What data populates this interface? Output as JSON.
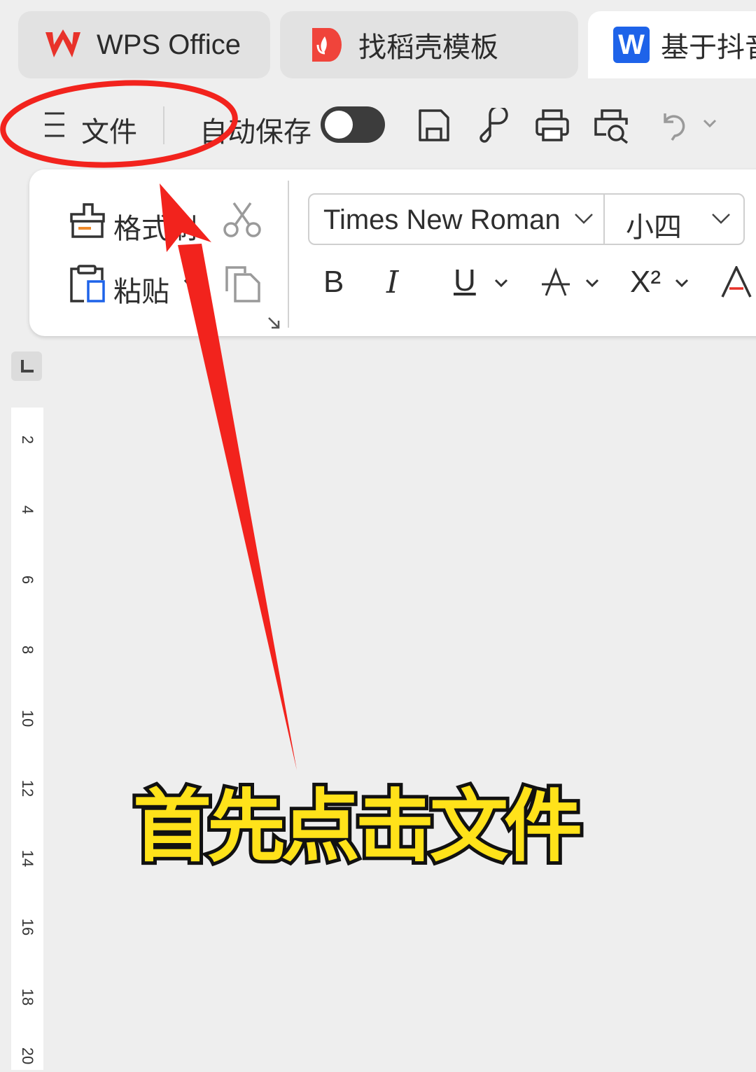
{
  "tabs": [
    {
      "label": "WPS Office"
    },
    {
      "label": "找稻壳模板"
    },
    {
      "label": "基于抖音"
    }
  ],
  "toolbar": {
    "file_label": "文件",
    "autosave_label": "自动保存",
    "autosave_on": false
  },
  "ribbon": {
    "format_painter_label": "格式刷",
    "paste_label": "粘贴",
    "font_name": "Times New Roman",
    "font_size": "小四",
    "bold": "B",
    "italic": "I",
    "underline": "U",
    "superscript": "X²",
    "font_color": "A"
  },
  "ruler": {
    "marks": [
      "2",
      "4",
      "6",
      "8",
      "10",
      "12",
      "14",
      "16",
      "18",
      "20"
    ]
  },
  "annotation": {
    "caption": "首先点击文件"
  },
  "colors": {
    "annotation_red": "#f2231d",
    "caption_yellow": "#ffe21a"
  }
}
